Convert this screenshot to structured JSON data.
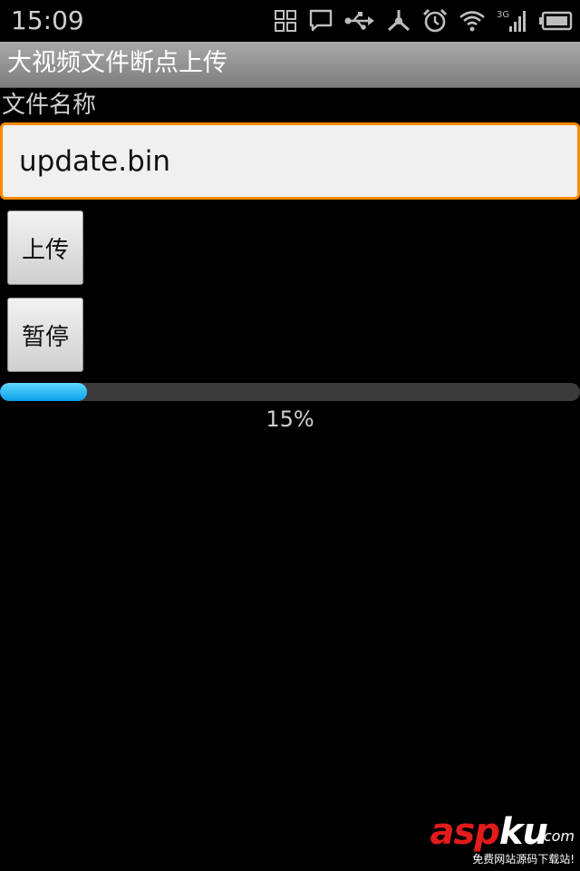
{
  "status_bar": {
    "time": "15:09",
    "icons": [
      "apps-grid-icon",
      "message-icon",
      "usb-icon",
      "debug-icon",
      "alarm-icon",
      "wifi-icon",
      "signal-3g-icon",
      "battery-icon"
    ],
    "network_type": "3G"
  },
  "title_bar": {
    "title": "大视频文件断点上传"
  },
  "form": {
    "filename_label": "文件名称",
    "filename_value": "update.bin",
    "upload_button_label": "上传",
    "pause_button_label": "暂停"
  },
  "progress": {
    "value": 0.15,
    "text": "15%"
  },
  "colors": {
    "focus_border": "#ff8a00",
    "progress_fill": "#0aa0e8",
    "title_bar": "#8f8f8f",
    "watermark_red": "#e21b1b"
  },
  "watermark": {
    "brand_a": "asp",
    "brand_b": "ku",
    "domain": ".com",
    "tagline": "免费网站源码下载站!"
  }
}
